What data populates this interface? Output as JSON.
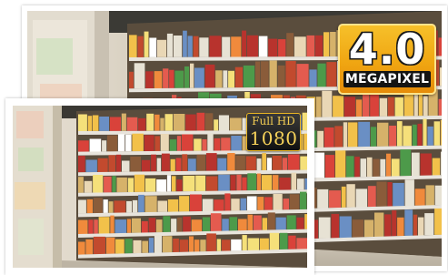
{
  "badges": {
    "megapixel": {
      "number": "4.0",
      "label": "MEGAPIXEL",
      "colors": {
        "background": "#f0a612",
        "label_background": "#141414",
        "text": "#ffffff"
      }
    },
    "full_hd": {
      "top": "Full HD",
      "number": "1080",
      "colors": {
        "background": "#1a1a1a",
        "text": "#f3cd52",
        "border": "#e9b523"
      }
    }
  },
  "photos": {
    "back": {
      "subject": "supermarket-shelves-photo",
      "resolution_label": "4.0 MEGAPIXEL"
    },
    "front": {
      "subject": "supermarket-shelves-photo",
      "resolution_label": "Full HD 1080"
    }
  }
}
